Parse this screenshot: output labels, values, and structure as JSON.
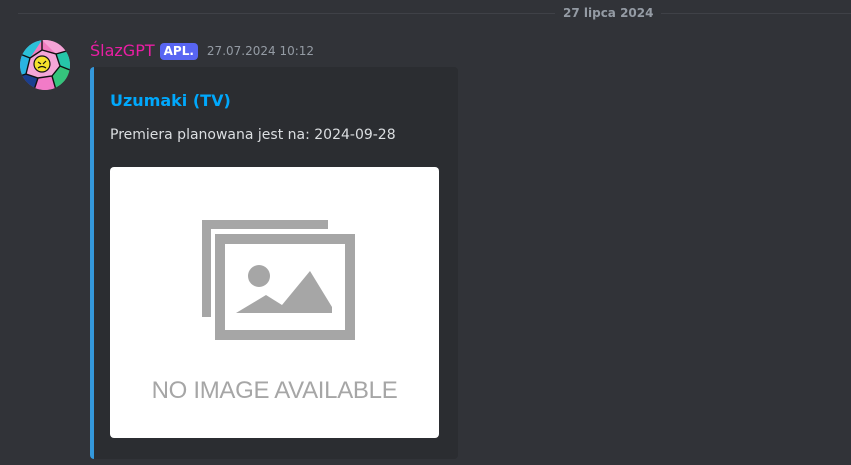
{
  "divider": {
    "date": "27 lipca 2024"
  },
  "message": {
    "author": "ŚlazGPT",
    "bot_tag": "APL.",
    "timestamp": "27.07.2024 10:12"
  },
  "embed": {
    "title": "Uzumaki (TV)",
    "description": "Premiera planowana jest na: 2024-09-28",
    "image_placeholder_text": "NO IMAGE AVAILABLE"
  },
  "colors": {
    "background": "#313338",
    "embed_background": "#2b2d31",
    "embed_accent": "#3498db",
    "author": "#e91ea3",
    "bot_tag": "#5865f2",
    "title_link": "#00a8fc",
    "muted": "#949ba4"
  },
  "icons": {
    "avatar": "avatar-image",
    "placeholder": "image-placeholder-icon"
  }
}
